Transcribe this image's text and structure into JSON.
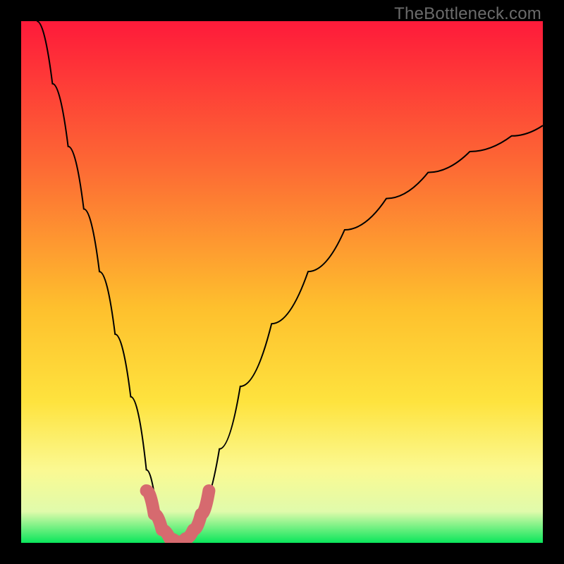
{
  "watermark": "TheBottleneck.com",
  "colors": {
    "frame": "#000000",
    "grad_top": "#fe1a3a",
    "grad_mid1": "#fd6a34",
    "grad_mid2": "#fec02d",
    "grad_mid3": "#fee33e",
    "grad_mid4": "#fbf992",
    "grad_low": "#e0fbab",
    "grad_bottom": "#0ae65b",
    "curve": "#000000",
    "highlight": "#d66a6f"
  },
  "chart_data": {
    "type": "line",
    "title": "",
    "xlabel": "",
    "ylabel": "",
    "xlim": [
      0,
      100
    ],
    "ylim": [
      0,
      100
    ],
    "grid": false,
    "legend": false,
    "annotations": [
      "TheBottleneck.com"
    ],
    "series": [
      {
        "name": "bottleneck-curve",
        "x": [
          3,
          6,
          9,
          12,
          15,
          18,
          21,
          24,
          26,
          28,
          30,
          32,
          34,
          38,
          42,
          48,
          55,
          62,
          70,
          78,
          86,
          94,
          100
        ],
        "y": [
          100,
          88,
          76,
          64,
          52,
          40,
          28,
          14,
          6,
          1,
          0,
          1,
          6,
          18,
          30,
          42,
          52,
          60,
          66,
          71,
          75,
          78,
          80
        ]
      },
      {
        "name": "bottleneck-highlight",
        "x": [
          24,
          25.5,
          27,
          28.5,
          30,
          31.5,
          33,
          34.5,
          36
        ],
        "y": [
          10,
          5.5,
          2.5,
          0.8,
          0,
          0.8,
          2.5,
          5.5,
          10
        ]
      }
    ]
  }
}
